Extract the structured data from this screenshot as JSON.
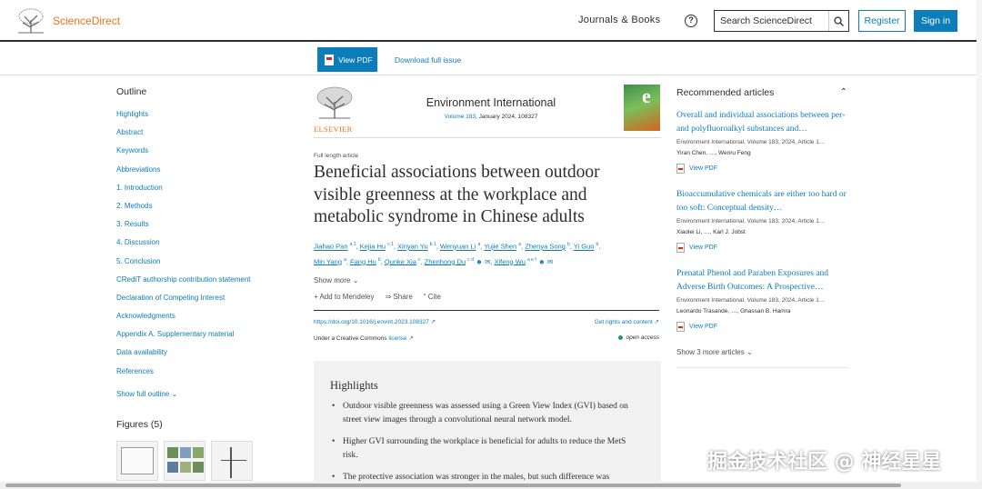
{
  "header": {
    "logo_text": "ScienceDirect",
    "nav_journals": "Journals & Books",
    "help_icon": "?",
    "search_placeholder": "Search ScienceDirect",
    "register": "Register",
    "signin": "Sign in"
  },
  "toolbar": {
    "view_pdf": "View PDF",
    "download_issue": "Download full issue"
  },
  "outline": {
    "title": "Outline",
    "items": [
      "Highlights",
      "Abstract",
      "Keywords",
      "Abbreviations",
      "1. Introduction",
      "2. Methods",
      "3. Results",
      "4. Discussion",
      "5. Conclusion",
      "CRediT authorship contribution statement",
      "Declaration of Competing Interest",
      "Acknowledgments",
      "Appendix A. Supplementary material",
      "Data availability",
      "References"
    ],
    "show_full": "Show full outline",
    "figures_title": "Figures (5)"
  },
  "journal": {
    "publisher": "ELSEVIER",
    "name": "Environment International",
    "volume_link": "Volume 183",
    "date_info": ", January 2024, 108327",
    "cover_letter": "e"
  },
  "article": {
    "type": "Full length article",
    "title": "Beneficial associations between outdoor visible greenness at the workplace and metabolic syndrome in Chinese adults",
    "authors": [
      {
        "name": "Jiahao Pan",
        "sup": "a 1"
      },
      {
        "name": "Kejia Hu",
        "sup": "c 1"
      },
      {
        "name": "Xinyan Yu",
        "sup": "b 1"
      },
      {
        "name": "Wenyuan Li",
        "sup": "a"
      },
      {
        "name": "Yujie Shen",
        "sup": "a"
      },
      {
        "name": "Zhenya Song",
        "sup": "b"
      },
      {
        "name": "Yi Guo",
        "sup": "b"
      },
      {
        "name": "Min Yang",
        "sup": "a"
      },
      {
        "name": "Fang Hu",
        "sup": "b"
      },
      {
        "name": "Qunke Xia",
        "sup": "c"
      },
      {
        "name": "Zhenhong Du",
        "sup": "c d"
      },
      {
        "name": "Xifeng Wu",
        "sup": "a e f"
      }
    ],
    "show_more": "Show more",
    "add_mendeley": "Add to Mendeley",
    "share": "Share",
    "cite": "Cite",
    "doi": "https://doi.org/10.1016/j.envint.2023.108327",
    "rights": "Get rights and content",
    "license_prefix": "Under a Creative Commons ",
    "license_link": "license",
    "open_access": "open access"
  },
  "highlights": {
    "title": "Highlights",
    "items": [
      "Outdoor visible greenness was assessed using a Green View Index (GVI) based on street view images through a convolutional neural network model.",
      "Higher GVI surrounding the workplace is beneficial for adults to reduce the MetS risk.",
      "The protective association was stronger in the males, but such difference was"
    ]
  },
  "recommended": {
    "title": "Recommended articles",
    "items": [
      {
        "title": "Overall and individual associations between per- and polyfluoroalkyl substances and…",
        "meta": "Environment International, Volume 183, 2024, Article 1…",
        "authors": "Yiran Chen, …, Wenru Feng",
        "pdf": "View PDF"
      },
      {
        "title": "Bioaccumulative chemicals are either too hard or too soft: Conceptual density…",
        "meta": "Environment International, Volume 183, 2024, Article 1…",
        "authors": "Xiaolei Li, …, Karl J. Jobst",
        "pdf": "View PDF"
      },
      {
        "title": "Prenatal Phenol and Paraben Exposures and Adverse Birth Outcomes: A Prospective…",
        "meta": "Environment International, Volume 183, 2024, Article 1…",
        "authors": "Leonardo Trasande, …, Ghassan B. Hamra",
        "pdf": "View PDF"
      }
    ],
    "show_more": "Show 3 more articles"
  },
  "watermark": "掘金技术社区 @ 神经星星",
  "colors": {
    "brand_orange": "#e9711c",
    "link_blue": "#0c7dbb",
    "text": "#2e2e2e"
  }
}
